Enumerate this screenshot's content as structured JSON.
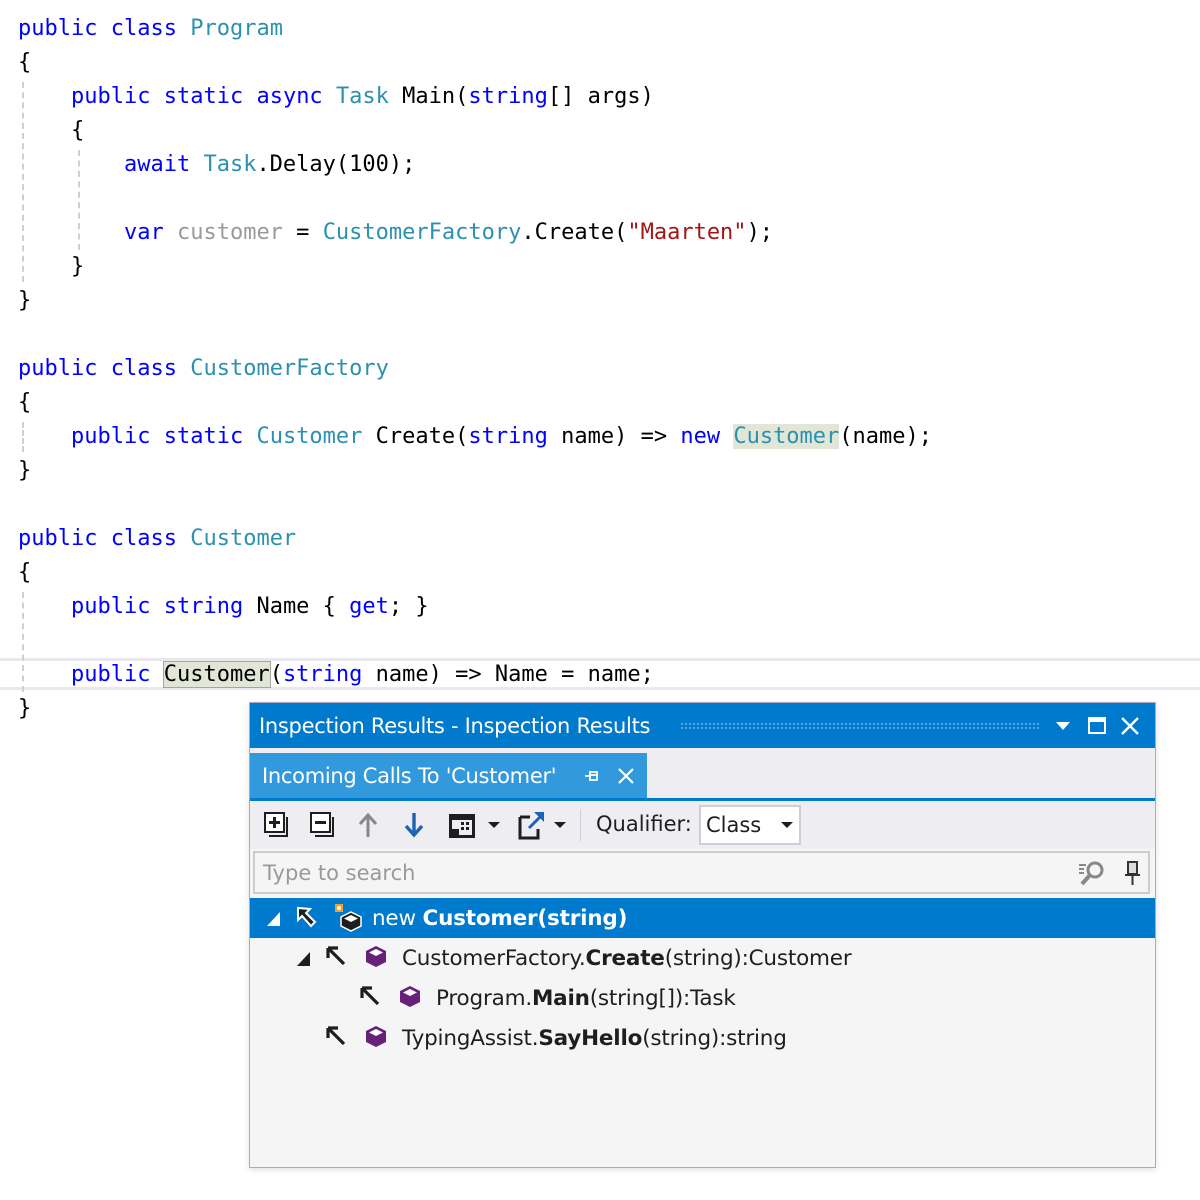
{
  "editor": {
    "lines": [
      {
        "tokens": [
          [
            "kw",
            "public"
          ],
          [
            "plain",
            " "
          ],
          [
            "kw",
            "class"
          ],
          [
            "plain",
            " "
          ],
          [
            "type",
            "Program"
          ]
        ]
      },
      {
        "tokens": [
          [
            "plain",
            "{"
          ]
        ]
      },
      {
        "tokens": [
          [
            "plain",
            "    "
          ],
          [
            "kw",
            "public"
          ],
          [
            "plain",
            " "
          ],
          [
            "kw",
            "static"
          ],
          [
            "plain",
            " "
          ],
          [
            "kw",
            "async"
          ],
          [
            "plain",
            " "
          ],
          [
            "type",
            "Task"
          ],
          [
            "plain",
            " Main("
          ],
          [
            "kw",
            "string"
          ],
          [
            "plain",
            "[] args)"
          ]
        ]
      },
      {
        "tokens": [
          [
            "plain",
            "    {"
          ]
        ]
      },
      {
        "tokens": [
          [
            "plain",
            "        "
          ],
          [
            "kw",
            "await"
          ],
          [
            "plain",
            " "
          ],
          [
            "type",
            "Task"
          ],
          [
            "plain",
            ".Delay(100);"
          ]
        ]
      },
      {
        "tokens": []
      },
      {
        "tokens": [
          [
            "plain",
            "        "
          ],
          [
            "kw",
            "var"
          ],
          [
            "plain",
            " "
          ],
          [
            "unused",
            "customer"
          ],
          [
            "plain",
            " = "
          ],
          [
            "type",
            "CustomerFactory"
          ],
          [
            "plain",
            ".Create("
          ],
          [
            "str",
            "\"Maarten\""
          ],
          [
            "plain",
            ");"
          ]
        ]
      },
      {
        "tokens": [
          [
            "plain",
            "    }"
          ]
        ]
      },
      {
        "tokens": [
          [
            "plain",
            "}"
          ]
        ]
      },
      {
        "tokens": []
      },
      {
        "tokens": [
          [
            "kw",
            "public"
          ],
          [
            "plain",
            " "
          ],
          [
            "kw",
            "class"
          ],
          [
            "plain",
            " "
          ],
          [
            "type",
            "CustomerFactory"
          ]
        ]
      },
      {
        "tokens": [
          [
            "plain",
            "{"
          ]
        ]
      },
      {
        "tokens": [
          [
            "plain",
            "    "
          ],
          [
            "kw",
            "public"
          ],
          [
            "plain",
            " "
          ],
          [
            "kw",
            "static"
          ],
          [
            "plain",
            " "
          ],
          [
            "type",
            "Customer"
          ],
          [
            "plain",
            " Create("
          ],
          [
            "kw",
            "string"
          ],
          [
            "plain",
            " name) => "
          ],
          [
            "kw",
            "new"
          ],
          [
            "plain",
            " "
          ],
          [
            "type-ref",
            "Customer"
          ],
          [
            "plain",
            "(name);"
          ]
        ]
      },
      {
        "tokens": [
          [
            "plain",
            "}"
          ]
        ]
      },
      {
        "tokens": []
      },
      {
        "tokens": [
          [
            "kw",
            "public"
          ],
          [
            "plain",
            " "
          ],
          [
            "kw",
            "class"
          ],
          [
            "plain",
            " "
          ],
          [
            "type",
            "Customer"
          ]
        ]
      },
      {
        "tokens": [
          [
            "plain",
            "{"
          ]
        ]
      },
      {
        "tokens": [
          [
            "plain",
            "    "
          ],
          [
            "kw",
            "public"
          ],
          [
            "plain",
            " "
          ],
          [
            "kw",
            "string"
          ],
          [
            "plain",
            " Name { "
          ],
          [
            "kw",
            "get"
          ],
          [
            "plain",
            "; }"
          ]
        ]
      },
      {
        "tokens": []
      },
      {
        "tokens": [
          [
            "plain",
            "    "
          ],
          [
            "kw",
            "public"
          ],
          [
            "plain",
            " "
          ],
          [
            "decl",
            "Customer"
          ],
          [
            "kw",
            "("
          ],
          [
            "kw",
            "string"
          ],
          [
            "plain",
            " name) => Name = name;"
          ]
        ]
      },
      {
        "tokens": [
          [
            "plain",
            "}"
          ]
        ]
      }
    ]
  },
  "inspection": {
    "title": "Inspection Results - Inspection Results",
    "title_buttons": {
      "menu": "dropdown-arrow",
      "maximize": "maximize",
      "close": "close"
    },
    "tab": {
      "label": "Incoming Calls To 'Customer'",
      "pin": "pin",
      "close": "close"
    },
    "toolbar": {
      "buttons": [
        "expand-all",
        "collapse-all",
        "previous",
        "next",
        "group-by",
        "export"
      ],
      "qualifier_label": "Qualifier:",
      "qualifier_value": "Class"
    },
    "search": {
      "placeholder": "Type to search",
      "value": ""
    },
    "tree": [
      {
        "level": 0,
        "expanded": true,
        "selected": true,
        "icon": "constructor-icon",
        "prefix": "new ",
        "bold": "Customer(string)",
        "suffix": ""
      },
      {
        "level": 1,
        "expanded": true,
        "selected": false,
        "icon": "method-icon",
        "prefix": "CustomerFactory.",
        "bold": "Create",
        "suffix": "(string):Customer"
      },
      {
        "level": 2,
        "expanded": null,
        "selected": false,
        "icon": "method-icon",
        "prefix": "Program.",
        "bold": "Main",
        "suffix": "(string[]):Task"
      },
      {
        "level": 1,
        "expanded": null,
        "selected": false,
        "icon": "method-icon",
        "prefix": "TypingAssist.",
        "bold": "SayHello",
        "suffix": "(string):string"
      }
    ],
    "colors": {
      "accent": "#007acc",
      "tab": "#3399dd",
      "method_icon": "#68217a"
    }
  }
}
